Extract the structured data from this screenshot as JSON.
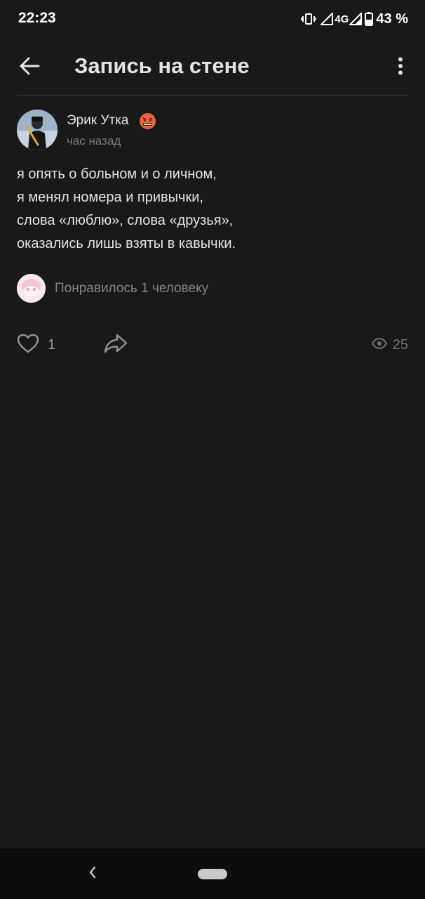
{
  "status_bar": {
    "time": "22:23",
    "network": "4G",
    "battery": "43 %",
    "icons": [
      "vibrate-icon",
      "signal-icon",
      "signal-4g-icon",
      "battery-icon"
    ]
  },
  "header": {
    "title": "Запись на стене",
    "back_icon": "arrow-left-icon",
    "more_icon": "more-vertical-icon"
  },
  "post": {
    "author": "Эрик Утка",
    "time": "час назад",
    "lines": [
      "я опять о больном и о личном,",
      "я менял номера и привычки,",
      "слова «люблю», слова «друзья»,",
      "оказались лишь взяты в кавычки."
    ],
    "likes_summary": "Понравилось 1 человеку",
    "like_count": "1",
    "views_count": "25"
  },
  "colors": {
    "background": "#191919",
    "text_primary": "#e1e3e6",
    "text_secondary": "#76787a",
    "navbar": "#0d0d0d"
  }
}
